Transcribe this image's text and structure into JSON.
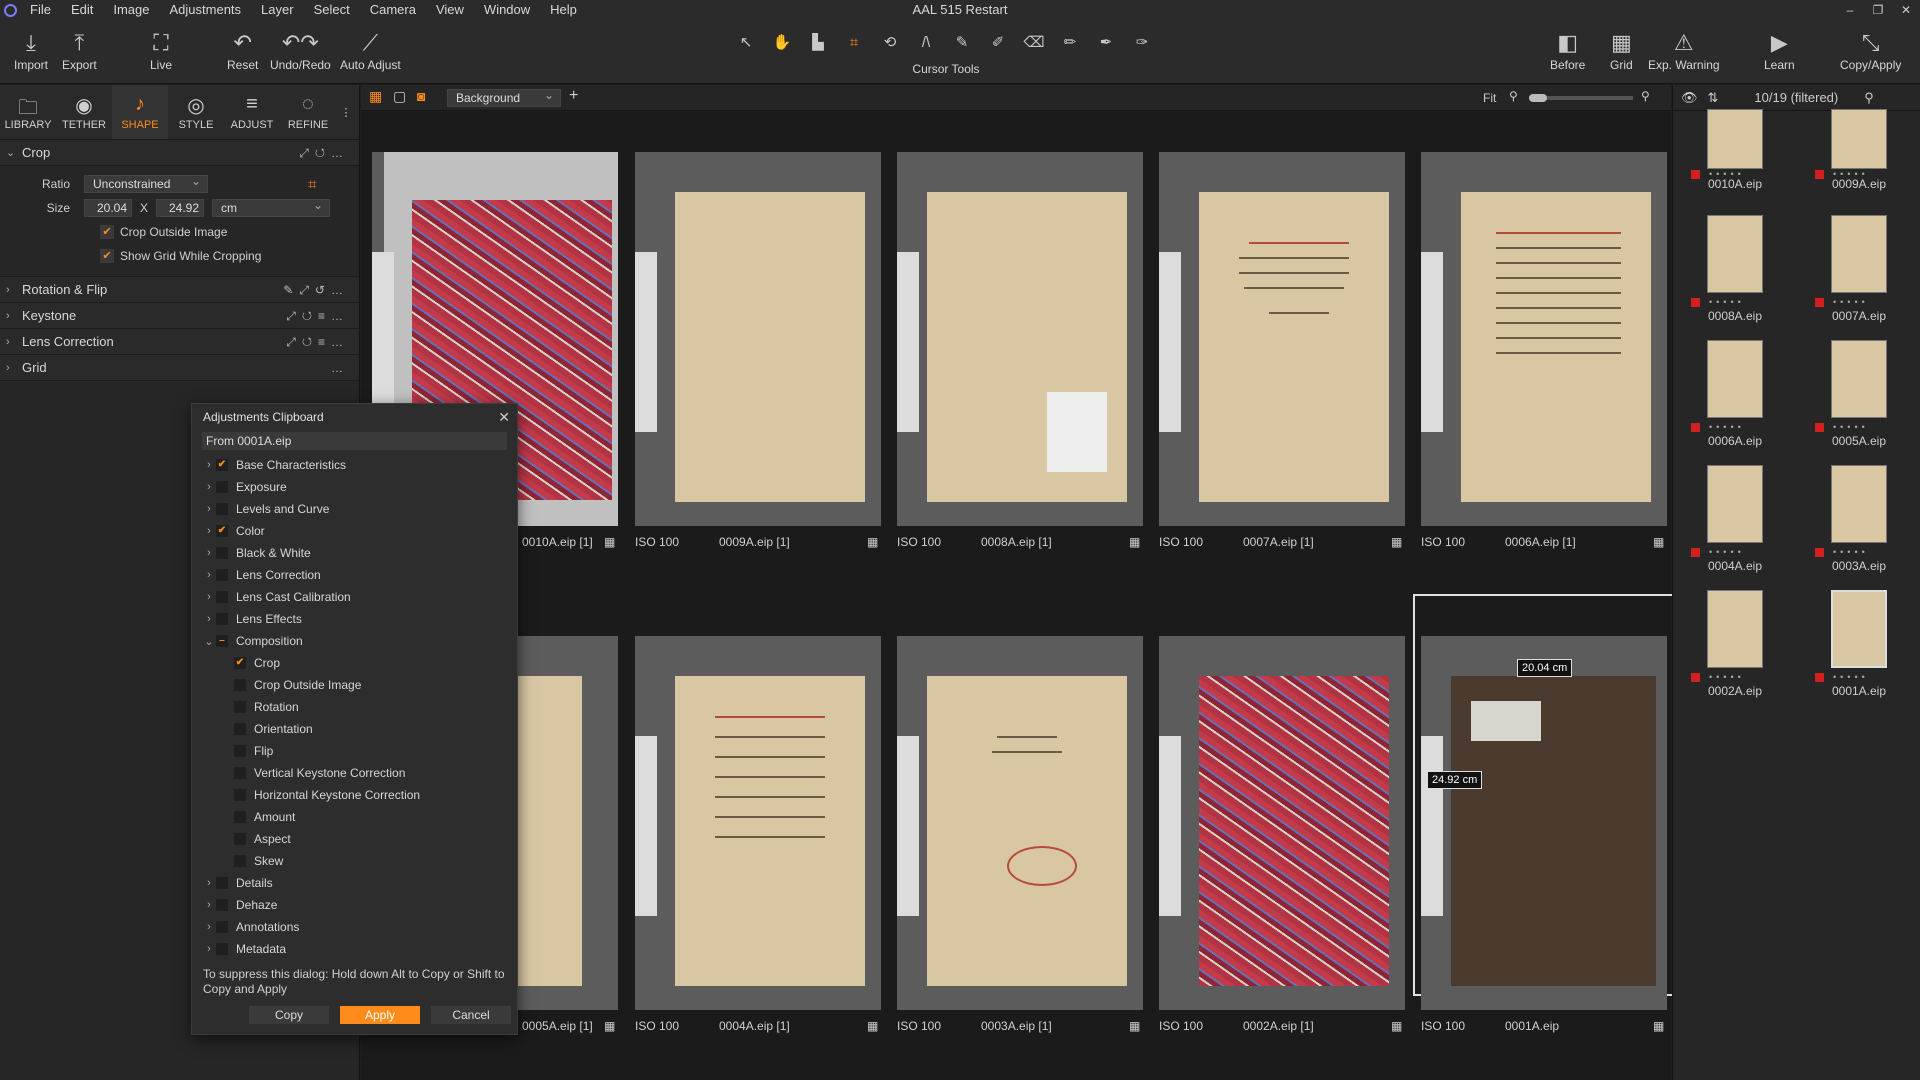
{
  "window": {
    "title": "AAL 515 Restart"
  },
  "menu": [
    "File",
    "Edit",
    "Image",
    "Adjustments",
    "Layer",
    "Select",
    "Camera",
    "View",
    "Window",
    "Help"
  ],
  "toolbar": {
    "import": "Import",
    "export": "Export",
    "live": "Live",
    "reset": "Reset",
    "undo_redo": "Undo/Redo",
    "auto_adjust": "Auto Adjust",
    "cursor_tools": "Cursor Tools",
    "before": "Before",
    "grid": "Grid",
    "exp_warning": "Exp. Warning",
    "learn": "Learn",
    "copy_apply": "Copy/Apply"
  },
  "tool_tabs": [
    "LIBRARY",
    "TETHER",
    "SHAPE",
    "STYLE",
    "ADJUST",
    "REFINE"
  ],
  "crop": {
    "title": "Crop",
    "ratio_label": "Ratio",
    "ratio_value": "Unconstrained",
    "size_label": "Size",
    "width": "20.04",
    "x": "X",
    "height": "24.92",
    "unit": "cm",
    "crop_outside": "Crop Outside Image",
    "show_grid": "Show Grid While Cropping"
  },
  "sections": [
    "Rotation & Flip",
    "Keystone",
    "Lens Correction",
    "Grid"
  ],
  "viewer": {
    "background": "Background",
    "fit": "Fit",
    "count": "10/19 (filtered)"
  },
  "grid_row1": [
    {
      "iso": "",
      "name": "0010A.eip [1]"
    },
    {
      "iso": "ISO 100",
      "name": "0009A.eip [1]"
    },
    {
      "iso": "ISO 100",
      "name": "0008A.eip [1]"
    },
    {
      "iso": "ISO 100",
      "name": "0007A.eip [1]"
    },
    {
      "iso": "ISO 100",
      "name": "0006A.eip [1]"
    }
  ],
  "grid_row2": [
    {
      "iso": "",
      "name": "0005A.eip [1]"
    },
    {
      "iso": "ISO 100",
      "name": "0004A.eip [1]"
    },
    {
      "iso": "ISO 100",
      "name": "0003A.eip [1]"
    },
    {
      "iso": "ISO 100",
      "name": "0002A.eip [1]"
    },
    {
      "iso": "ISO 100",
      "name": "0001A.eip"
    }
  ],
  "crop_tags": {
    "width": "20.04 cm",
    "height": "24.92 cm"
  },
  "filmstrip": [
    "0010A.eip",
    "0009A.eip",
    "0008A.eip",
    "0007A.eip",
    "0006A.eip",
    "0005A.eip",
    "0004A.eip",
    "0003A.eip",
    "0002A.eip",
    "0001A.eip"
  ],
  "dialog": {
    "title": "Adjustments Clipboard",
    "from": "From 0001A.eip",
    "items": [
      {
        "label": "Base Characteristics",
        "checked": true,
        "expand": "›",
        "sub": false
      },
      {
        "label": "Exposure",
        "checked": false,
        "expand": "›",
        "sub": false
      },
      {
        "label": "Levels and Curve",
        "checked": false,
        "expand": "›",
        "sub": false
      },
      {
        "label": "Color",
        "checked": true,
        "expand": "›",
        "sub": false
      },
      {
        "label": "Black & White",
        "checked": false,
        "expand": "›",
        "sub": false
      },
      {
        "label": "Lens Correction",
        "checked": false,
        "expand": "›",
        "sub": false
      },
      {
        "label": "Lens Cast Calibration",
        "checked": false,
        "expand": "›",
        "sub": false
      },
      {
        "label": "Lens Effects",
        "checked": false,
        "expand": "›",
        "sub": false
      },
      {
        "label": "Composition",
        "checked": "partial",
        "expand": "⌄",
        "sub": false
      },
      {
        "label": "Crop",
        "checked": true,
        "expand": "",
        "sub": true
      },
      {
        "label": "Crop Outside Image",
        "checked": false,
        "expand": "",
        "sub": true
      },
      {
        "label": "Rotation",
        "checked": false,
        "expand": "",
        "sub": true
      },
      {
        "label": "Orientation",
        "checked": false,
        "expand": "",
        "sub": true
      },
      {
        "label": "Flip",
        "checked": false,
        "expand": "",
        "sub": true
      },
      {
        "label": "Vertical Keystone Correction",
        "checked": false,
        "expand": "",
        "sub": true
      },
      {
        "label": "Horizontal Keystone Correction",
        "checked": false,
        "expand": "",
        "sub": true
      },
      {
        "label": "Amount",
        "checked": false,
        "expand": "",
        "sub": true
      },
      {
        "label": "Aspect",
        "checked": false,
        "expand": "",
        "sub": true
      },
      {
        "label": "Skew",
        "checked": false,
        "expand": "",
        "sub": true
      },
      {
        "label": "Details",
        "checked": false,
        "expand": "›",
        "sub": false
      },
      {
        "label": "Dehaze",
        "checked": false,
        "expand": "›",
        "sub": false
      },
      {
        "label": "Annotations",
        "checked": false,
        "expand": "›",
        "sub": false
      },
      {
        "label": "Metadata",
        "checked": false,
        "expand": "›",
        "sub": false
      }
    ],
    "note": "To suppress this dialog: Hold down Alt to Copy or Shift to Copy and Apply",
    "copy": "Copy",
    "apply": "Apply",
    "cancel": "Cancel"
  }
}
